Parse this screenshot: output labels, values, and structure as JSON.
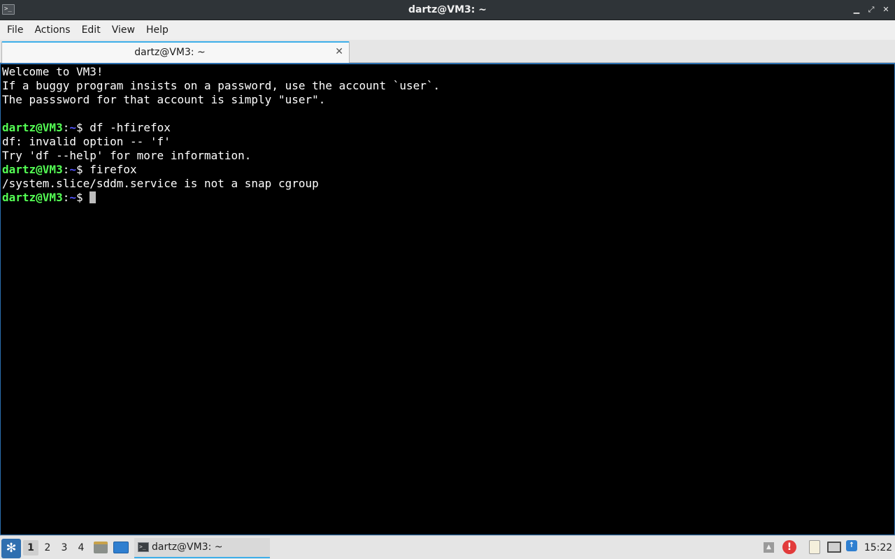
{
  "window": {
    "title": "dartz@VM3: ~",
    "app_icon": "terminal-icon",
    "controls": {
      "minimize": "▁",
      "maximize": "⤢",
      "close": "✕"
    }
  },
  "menu": [
    "File",
    "Actions",
    "Edit",
    "View",
    "Help"
  ],
  "tabs": [
    {
      "label": "dartz@VM3: ~",
      "close": "✕",
      "active": true
    }
  ],
  "terminal": {
    "colors": {
      "background": "#000000",
      "text": "#ffffff",
      "prompt_user": "#54ff54",
      "prompt_path": "#5454ff",
      "cursor": "#bdbdbd"
    },
    "prompt": {
      "user_host": "dartz@VM3",
      "sep": ":",
      "path": "~",
      "symbol": "$"
    },
    "lines": [
      {
        "type": "output",
        "text": "Welcome to VM3!"
      },
      {
        "type": "output",
        "text": "If a buggy program insists on a password, use the account `user`."
      },
      {
        "type": "output",
        "text": "The passsword for that account is simply \"user\"."
      },
      {
        "type": "output",
        "text": ""
      },
      {
        "type": "prompt",
        "command": " df -hfirefox"
      },
      {
        "type": "output",
        "text": "df: invalid option -- 'f'"
      },
      {
        "type": "output",
        "text": "Try 'df --help' for more information."
      },
      {
        "type": "prompt",
        "command": " firefox"
      },
      {
        "type": "output",
        "text": "/system.slice/sddm.service is not a snap cgroup"
      },
      {
        "type": "prompt",
        "command": " ",
        "cursor": true
      }
    ]
  },
  "taskbar": {
    "start_icon": "start-menu-icon",
    "workspaces": [
      "1",
      "2",
      "3",
      "4"
    ],
    "active_workspace": "1",
    "launchers": [
      "file-manager-icon",
      "show-desktop-icon"
    ],
    "task": {
      "label": "dartz@VM3: ~",
      "icon": "terminal-icon"
    },
    "tray": {
      "up": "▲",
      "alert": "!",
      "update": "↑"
    },
    "clock": "15:22"
  }
}
